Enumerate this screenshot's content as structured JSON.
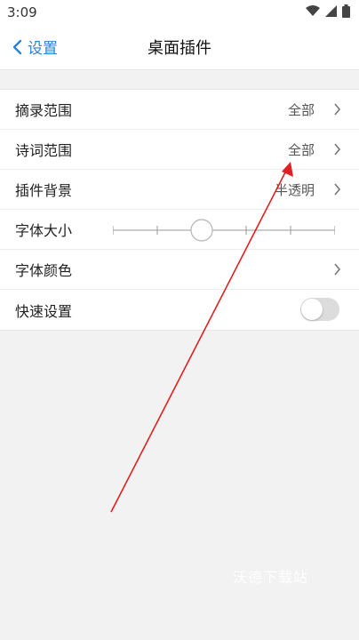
{
  "status_bar": {
    "time": "3:09",
    "icons": [
      "wifi-icon",
      "signal-icon",
      "battery-icon"
    ]
  },
  "header": {
    "back_label": "设置",
    "title": "桌面插件"
  },
  "rows": [
    {
      "label": "摘录范围",
      "value": "全部"
    },
    {
      "label": "诗词范围",
      "value": "全部"
    },
    {
      "label": "插件背景",
      "value": "半透明"
    },
    {
      "label": "字体大小",
      "slider_level": 0.4
    },
    {
      "label": "字体颜色",
      "value": ""
    },
    {
      "label": "快速设置",
      "toggle": false
    }
  ],
  "watermark": "沃德下载站",
  "colors": {
    "accent": "#2c82d8",
    "annotation": "#e02020"
  }
}
